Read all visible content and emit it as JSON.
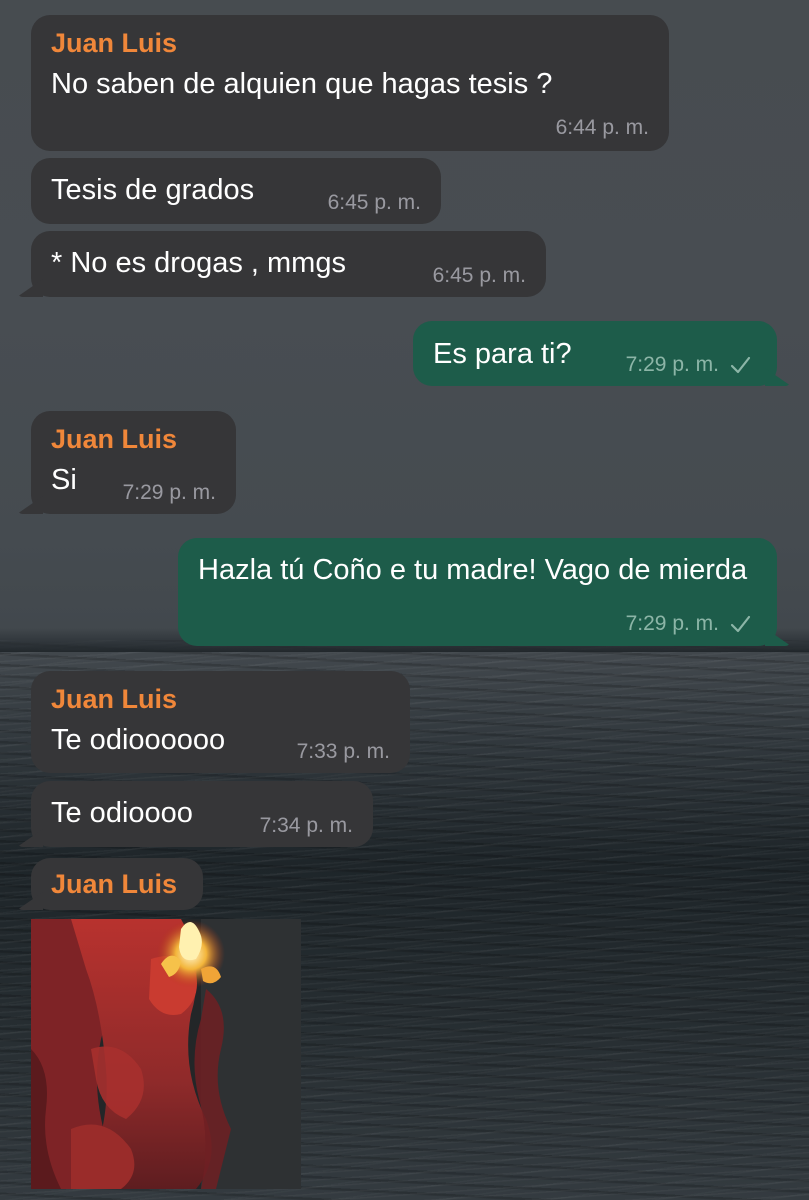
{
  "chat": {
    "messages": [
      {
        "sender": "Juan Luis",
        "text": "No saben de alquien que hagas tesis ?",
        "time": "6:44 p. m."
      },
      {
        "text": "Tesis de grados",
        "time": "6:45 p. m."
      },
      {
        "text": "* No es drogas , mmgs",
        "time": "6:45 p. m."
      },
      {
        "text": "Es para ti?",
        "time": "7:29 p. m.",
        "status": "sent-check-icon"
      },
      {
        "sender": "Juan Luis",
        "text": "Si",
        "time": "7:29 p. m."
      },
      {
        "text": "Hazla tú Coño e tu madre! Vago de mierda",
        "time": "7:29 p. m.",
        "status": "sent-check-icon"
      },
      {
        "sender": "Juan Luis",
        "text": "Te odioooooo",
        "time": "7:33 p. m."
      },
      {
        "text": "Te odioooo",
        "time": "7:34 p. m."
      },
      {
        "sender": "Juan Luis",
        "media": "animated-gif"
      }
    ]
  },
  "colors": {
    "incoming_bubble": "#363638",
    "outgoing_bubble": "#1d5c4a",
    "sender_name": "#f0873a",
    "message_text": "#ffffff"
  }
}
